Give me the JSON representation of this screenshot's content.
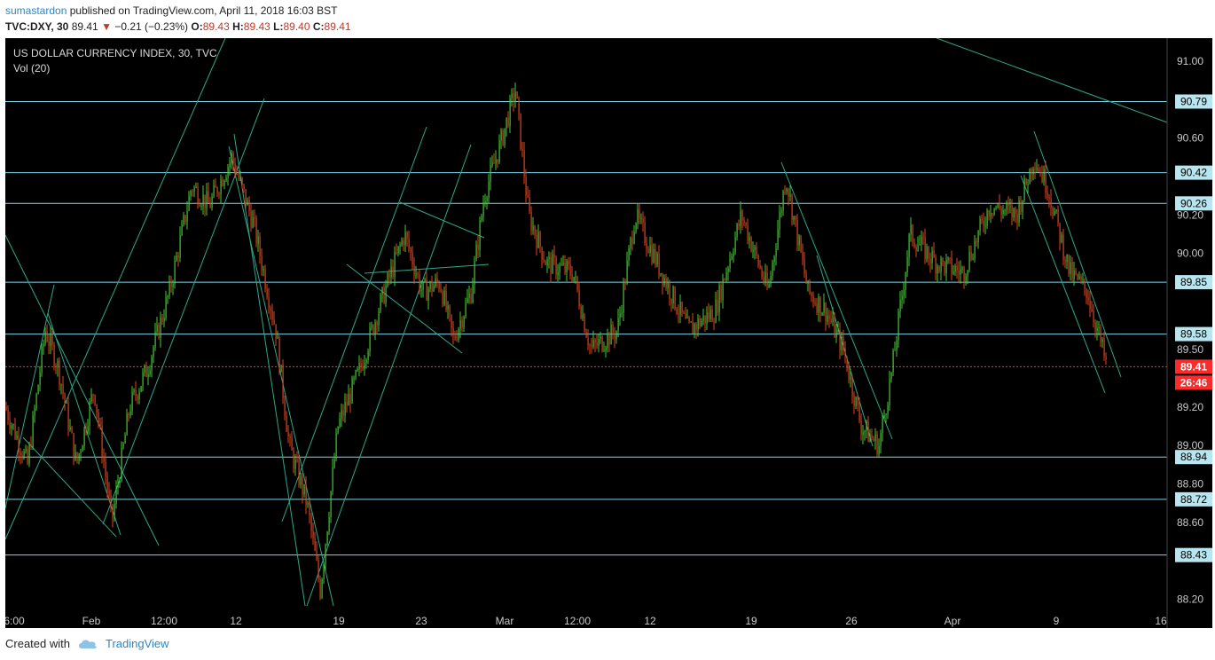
{
  "header": {
    "author": "sumastardon",
    "published_text": "published on TradingView.com, April 11, 2018 16:03 BST",
    "symbol": "TVC:DXY, 30",
    "last": "89.41",
    "change": "−0.21 (−0.23%)",
    "o_label": "O:",
    "o_val": "89.43",
    "h_label": "H:",
    "h_val": "89.43",
    "l_label": "L:",
    "l_val": "89.40",
    "c_label": "C:",
    "c_val": "89.41"
  },
  "chart_data": {
    "type": "candlestick",
    "title": "US DOLLAR CURRENCY INDEX, 30, TVC",
    "indicator": "Vol (20)",
    "ylim": [
      88.05,
      91.12
    ],
    "y_ticks": [
      "91.00",
      "90.60",
      "90.20",
      "90.00",
      "89.50",
      "89.20",
      "89.00",
      "88.80",
      "88.60",
      "88.20"
    ],
    "x_ticks": [
      "6:00",
      "Feb",
      "12:00",
      "12",
      "19",
      "23",
      "Mar",
      "12:00",
      "12",
      "19",
      "26",
      "Apr",
      "9",
      "16"
    ],
    "horizontal_levels": [
      "90.79",
      "90.42",
      "90.26",
      "89.85",
      "89.58",
      "88.94",
      "88.72",
      "88.43"
    ],
    "current_price": "89.41",
    "countdown": "26:46",
    "price_path": [
      [
        0,
        89.2
      ],
      [
        25,
        88.9
      ],
      [
        45,
        89.6
      ],
      [
        60,
        89.4
      ],
      [
        80,
        88.9
      ],
      [
        100,
        89.3
      ],
      [
        120,
        88.6
      ],
      [
        140,
        89.2
      ],
      [
        160,
        89.4
      ],
      [
        185,
        89.8
      ],
      [
        210,
        90.35
      ],
      [
        230,
        90.25
      ],
      [
        255,
        90.5
      ],
      [
        280,
        90.15
      ],
      [
        305,
        89.6
      ],
      [
        320,
        89.0
      ],
      [
        340,
        88.7
      ],
      [
        355,
        88.25
      ],
      [
        375,
        89.1
      ],
      [
        400,
        89.4
      ],
      [
        420,
        89.7
      ],
      [
        450,
        90.1
      ],
      [
        470,
        89.8
      ],
      [
        490,
        89.85
      ],
      [
        505,
        89.55
      ],
      [
        525,
        89.8
      ],
      [
        540,
        90.3
      ],
      [
        560,
        90.6
      ],
      [
        575,
        90.85
      ],
      [
        590,
        90.2
      ],
      [
        610,
        89.95
      ],
      [
        640,
        89.9
      ],
      [
        660,
        89.5
      ],
      [
        690,
        89.6
      ],
      [
        710,
        90.2
      ],
      [
        740,
        89.9
      ],
      [
        770,
        89.6
      ],
      [
        800,
        89.7
      ],
      [
        830,
        90.2
      ],
      [
        860,
        89.8
      ],
      [
        880,
        90.4
      ],
      [
        905,
        89.8
      ],
      [
        925,
        89.7
      ],
      [
        945,
        89.5
      ],
      [
        965,
        89.1
      ],
      [
        985,
        89.0
      ],
      [
        1000,
        89.4
      ],
      [
        1020,
        90.1
      ],
      [
        1050,
        89.95
      ],
      [
        1080,
        89.9
      ],
      [
        1110,
        90.25
      ],
      [
        1140,
        90.2
      ],
      [
        1160,
        90.5
      ],
      [
        1175,
        90.35
      ],
      [
        1200,
        89.9
      ],
      [
        1220,
        89.8
      ],
      [
        1242,
        89.41
      ]
    ]
  },
  "footer": {
    "created_with": "Created with",
    "brand": "TradingView"
  },
  "colors": {
    "up": "#3fd12f",
    "down": "#e8431d",
    "level": "#7fd6e8",
    "trend": "#2fa889",
    "bg": "#000000",
    "axis_text": "#c8c8c8",
    "price_tag": "#ff2b2b"
  }
}
